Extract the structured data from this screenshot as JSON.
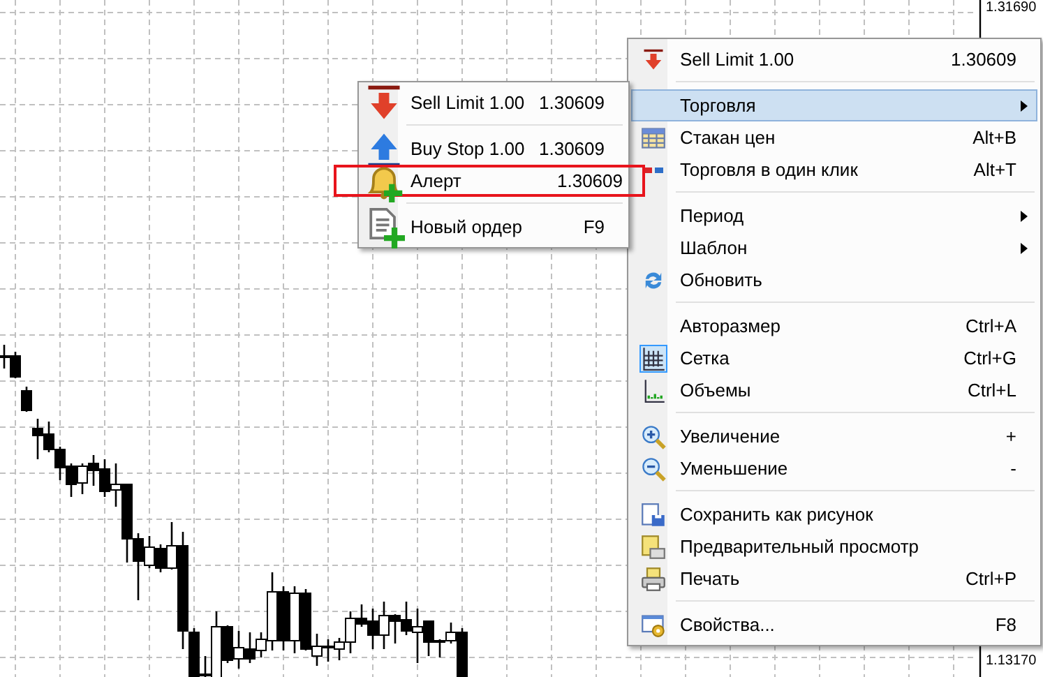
{
  "price_scale": {
    "labels": [
      "1.31690",
      "1.13170"
    ]
  },
  "context_menu": {
    "items": [
      {
        "kind": "item",
        "label": "Sell Limit 1.00",
        "shortcut": "1.30609",
        "has_submenu": false,
        "selected": false,
        "checked": false
      },
      {
        "kind": "separator"
      },
      {
        "kind": "item",
        "label": "Торговля",
        "has_submenu": true,
        "selected": true,
        "checked": false
      },
      {
        "kind": "item",
        "label": "Стакан цен",
        "shortcut": "Alt+B",
        "has_submenu": false,
        "selected": false,
        "checked": false
      },
      {
        "kind": "item",
        "label": "Торговля в один клик",
        "shortcut": "Alt+T",
        "has_submenu": false,
        "selected": false,
        "checked": false
      },
      {
        "kind": "separator"
      },
      {
        "kind": "item",
        "label": "Период",
        "has_submenu": true,
        "selected": false,
        "checked": false
      },
      {
        "kind": "item",
        "label": "Шаблон",
        "has_submenu": true,
        "selected": false,
        "checked": false
      },
      {
        "kind": "item",
        "label": "Обновить",
        "has_submenu": false,
        "selected": false,
        "checked": false
      },
      {
        "kind": "separator"
      },
      {
        "kind": "item",
        "label": "Авторазмер",
        "shortcut": "Ctrl+A",
        "has_submenu": false,
        "selected": false,
        "checked": false
      },
      {
        "kind": "item",
        "label": "Сетка",
        "shortcut": "Ctrl+G",
        "has_submenu": false,
        "selected": false,
        "checked": true
      },
      {
        "kind": "item",
        "label": "Объемы",
        "shortcut": "Ctrl+L",
        "has_submenu": false,
        "selected": false,
        "checked": false
      },
      {
        "kind": "separator"
      },
      {
        "kind": "item",
        "label": "Увеличение",
        "shortcut": "+",
        "has_submenu": false,
        "selected": false,
        "checked": false
      },
      {
        "kind": "item",
        "label": "Уменьшение",
        "shortcut": "-",
        "has_submenu": false,
        "selected": false,
        "checked": false
      },
      {
        "kind": "separator"
      },
      {
        "kind": "item",
        "label": "Сохранить как рисунок",
        "has_submenu": false,
        "selected": false,
        "checked": false
      },
      {
        "kind": "item",
        "label": "Предварительный просмотр",
        "has_submenu": false,
        "selected": false,
        "checked": false
      },
      {
        "kind": "item",
        "label": "Печать",
        "shortcut": "Ctrl+P",
        "has_submenu": false,
        "selected": false,
        "checked": false
      },
      {
        "kind": "separator"
      },
      {
        "kind": "item",
        "label": "Свойства...",
        "shortcut": "F8",
        "has_submenu": false,
        "selected": false,
        "checked": false
      }
    ]
  },
  "submenu": {
    "items": [
      {
        "kind": "item",
        "label": "Sell Limit 1.00",
        "shortcut": "1.30609",
        "highlighted": false
      },
      {
        "kind": "separator"
      },
      {
        "kind": "item",
        "label": "Buy Stop 1.00",
        "shortcut": "1.30609",
        "highlighted": false
      },
      {
        "kind": "item",
        "label": "Алерт",
        "shortcut": "1.30609",
        "highlighted": true
      },
      {
        "kind": "separator"
      },
      {
        "kind": "item",
        "label": "Новый ордер",
        "shortcut": "F9",
        "highlighted": false
      }
    ]
  }
}
